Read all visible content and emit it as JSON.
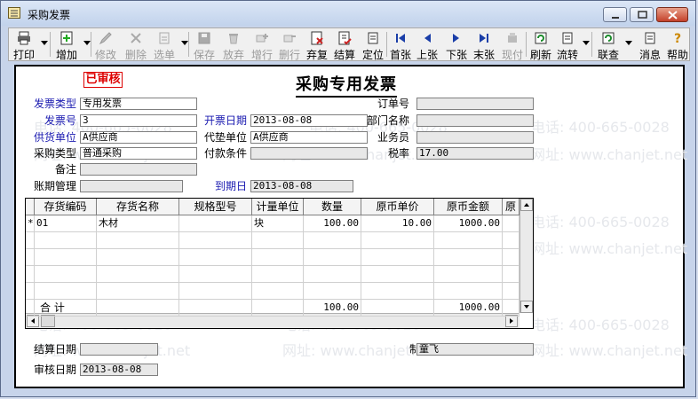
{
  "window": {
    "title": "采购发票"
  },
  "toolbar": {
    "buttons": [
      {
        "label": "打印",
        "icon": "printer-icon",
        "enabled": true
      },
      {
        "label": "增加",
        "icon": "add-icon",
        "enabled": true
      },
      {
        "label": "修改",
        "icon": "edit-icon",
        "enabled": false
      },
      {
        "label": "删除",
        "icon": "delete-icon",
        "enabled": false
      },
      {
        "label": "选单",
        "icon": "select-doc-icon",
        "enabled": false
      },
      {
        "label": "保存",
        "icon": "save-icon",
        "enabled": false
      },
      {
        "label": "放弃",
        "icon": "discard-icon",
        "enabled": false
      },
      {
        "label": "增行",
        "icon": "add-row-icon",
        "enabled": false
      },
      {
        "label": "删行",
        "icon": "delete-row-icon",
        "enabled": false
      },
      {
        "label": "弃复",
        "icon": "unapprove-icon",
        "enabled": true
      },
      {
        "label": "结算",
        "icon": "settle-icon",
        "enabled": true
      },
      {
        "label": "定位",
        "icon": "locate-icon",
        "enabled": true
      },
      {
        "label": "首张",
        "icon": "first-icon",
        "enabled": true
      },
      {
        "label": "上张",
        "icon": "prev-icon",
        "enabled": true
      },
      {
        "label": "下张",
        "icon": "next-icon",
        "enabled": true
      },
      {
        "label": "末张",
        "icon": "last-icon",
        "enabled": true
      },
      {
        "label": "现付",
        "icon": "cash-pay-icon",
        "enabled": false
      },
      {
        "label": "刷新",
        "icon": "refresh-icon",
        "enabled": true
      },
      {
        "label": "流转",
        "icon": "flow-icon",
        "enabled": true
      },
      {
        "label": "联查",
        "icon": "linked-query-icon",
        "enabled": true
      },
      {
        "label": "消息",
        "icon": "message-icon",
        "enabled": true
      },
      {
        "label": "帮助",
        "icon": "help-icon",
        "enabled": true
      }
    ]
  },
  "form": {
    "status_stamp": "已审核",
    "title": "采购专用发票",
    "fields": {
      "invoice_type": {
        "label": "发票类型",
        "value": "专用发票"
      },
      "invoice_no": {
        "label": "发票号",
        "value": "3"
      },
      "supplier": {
        "label": "供货单位",
        "value": "A供应商"
      },
      "purchase_type": {
        "label": "采购类型",
        "value": "普通采购"
      },
      "remark": {
        "label": "备注",
        "value": ""
      },
      "account_period": {
        "label": "账期管理",
        "value": ""
      },
      "invoice_date": {
        "label": "开票日期",
        "value": "2013-08-08"
      },
      "agent_unit": {
        "label": "代垫单位",
        "value": "A供应商"
      },
      "payment_terms": {
        "label": "付款条件",
        "value": ""
      },
      "due_date": {
        "label": "到期日",
        "value": "2013-08-08"
      },
      "order_no": {
        "label": "订单号",
        "value": ""
      },
      "department": {
        "label": "部门名称",
        "value": ""
      },
      "salesperson": {
        "label": "业务员",
        "value": ""
      },
      "tax_rate": {
        "label": "税率",
        "value": "17.00"
      },
      "settle_date": {
        "label": "结算日期",
        "value": ""
      },
      "maker": {
        "label": "制单",
        "value": "童飞"
      },
      "audit_date": {
        "label": "审核日期",
        "value": "2013-08-08"
      }
    },
    "grid": {
      "columns": [
        "存货编码",
        "存货名称",
        "规格型号",
        "计量单位",
        "数量",
        "原币单价",
        "原币金额",
        "原"
      ],
      "rows": [
        {
          "marker": "*",
          "code": "01",
          "name": "木材",
          "spec": "",
          "unit": "块",
          "qty": "100.00",
          "price": "10.00",
          "amount": "1000.00"
        }
      ],
      "total": {
        "label": "合  计",
        "qty": "100.00",
        "amount": "1000.00"
      }
    },
    "watermarks": [
      "电话: 400-665-0028",
      "网址: www.chanjet.net"
    ]
  }
}
